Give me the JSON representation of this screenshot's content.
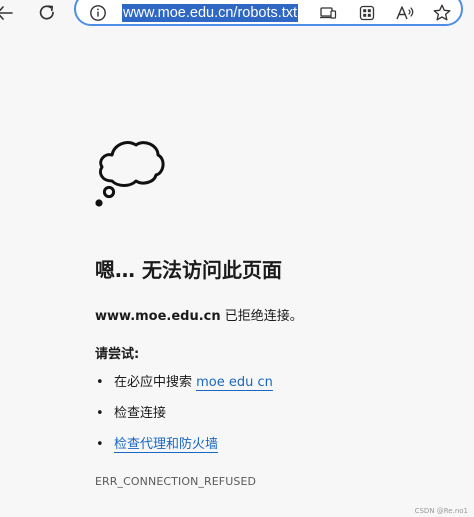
{
  "browser": {
    "url": "www.moe.edu.cn/robots.txt",
    "icons": {
      "back": "back-arrow-icon",
      "refresh": "refresh-icon",
      "info": "info-icon",
      "device": "device-icon",
      "apps": "apps-icon",
      "read_aloud": "read-aloud-icon",
      "favorite": "star-icon"
    },
    "accent_color": "#4f8ee6",
    "selection_color": "#2f67c4"
  },
  "error": {
    "title": "嗯… 无法访问此页面",
    "host": "www.moe.edu.cn",
    "message": " 已拒绝连接。",
    "try_heading": "请尝试:",
    "suggestions": {
      "s1_prefix": "在必应中搜索 ",
      "s1_link": "moe edu cn",
      "s2": "检查连接",
      "s3_link": "检查代理和防火墙"
    },
    "code": "ERR_CONNECTION_REFUSED",
    "link_color": "#1967c4"
  },
  "watermark": "CSDN @Re.no1"
}
